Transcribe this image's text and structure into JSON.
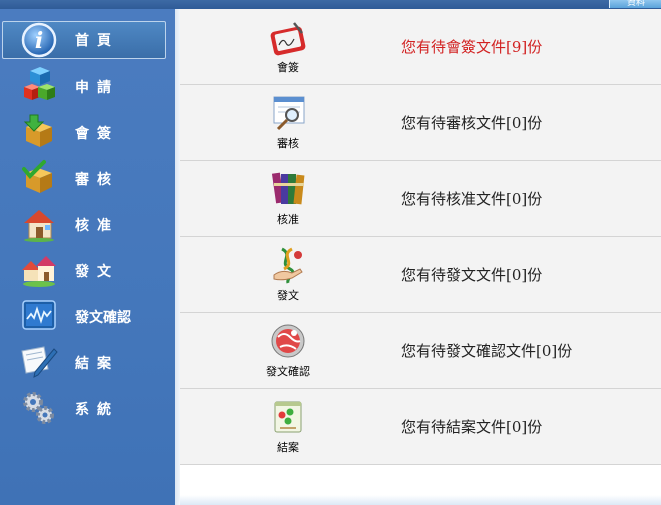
{
  "top_button": "資料",
  "sidebar": {
    "items": [
      {
        "label": "首頁",
        "icon": "info-icon",
        "active": true
      },
      {
        "label": "申請",
        "icon": "cubes-icon"
      },
      {
        "label": "會簽",
        "icon": "box-down-arrow-icon"
      },
      {
        "label": "審核",
        "icon": "box-check-icon"
      },
      {
        "label": "核准",
        "icon": "house-icon"
      },
      {
        "label": "發文",
        "icon": "houses-icon"
      },
      {
        "label": "發文確認",
        "icon": "chart-monitor-icon"
      },
      {
        "label": "結案",
        "icon": "pen-paper-icon"
      },
      {
        "label": "系統",
        "icon": "gears-icon"
      }
    ]
  },
  "tasks": [
    {
      "caption": "會簽",
      "message": "您有待會簽文件[9]份",
      "icon": "signature-tablet-icon",
      "alert": true
    },
    {
      "caption": "審核",
      "message": "您有待審核文件[0]份",
      "icon": "magnifier-document-icon"
    },
    {
      "caption": "核准",
      "message": "您有待核准文件[0]份",
      "icon": "books-icon"
    },
    {
      "caption": "發文",
      "message": "您有待發文文件[0]份",
      "icon": "dna-hand-icon"
    },
    {
      "caption": "發文確認",
      "message": "您有待發文確認文件[0]份",
      "icon": "globe-check-icon"
    },
    {
      "caption": "結案",
      "message": "您有待結案文件[0]份",
      "icon": "notepad-icon"
    }
  ]
}
